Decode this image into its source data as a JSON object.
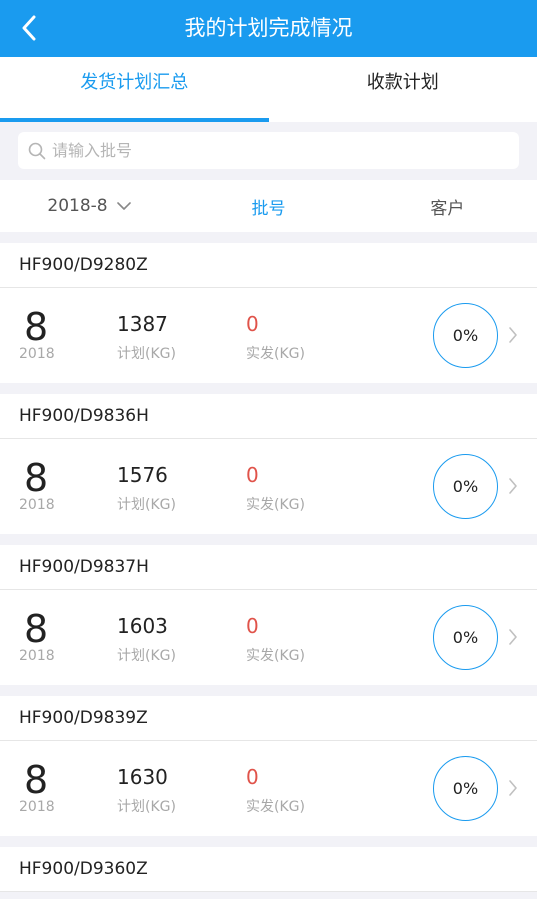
{
  "header": {
    "title": "我的计划完成情况"
  },
  "tabs": [
    {
      "label": "发货计划汇总",
      "active": true
    },
    {
      "label": "收款计划",
      "active": false
    }
  ],
  "search": {
    "placeholder": "请输入批号"
  },
  "filter": {
    "date": "2018-8",
    "batch": "批号",
    "customer": "客户"
  },
  "colors": {
    "accent": "#1a9bef",
    "actual": "#e0534a"
  },
  "items": [
    {
      "batch": "HF900/D9280Z",
      "month": "8",
      "year": "2018",
      "plan_value": "1387",
      "plan_label": "计划(KG)",
      "actual_value": "0",
      "actual_label": "实发(KG)",
      "percent": "0%"
    },
    {
      "batch": "HF900/D9836H",
      "month": "8",
      "year": "2018",
      "plan_value": "1576",
      "plan_label": "计划(KG)",
      "actual_value": "0",
      "actual_label": "实发(KG)",
      "percent": "0%"
    },
    {
      "batch": "HF900/D9837H",
      "month": "8",
      "year": "2018",
      "plan_value": "1603",
      "plan_label": "计划(KG)",
      "actual_value": "0",
      "actual_label": "实发(KG)",
      "percent": "0%"
    },
    {
      "batch": "HF900/D9839Z",
      "month": "8",
      "year": "2018",
      "plan_value": "1630",
      "plan_label": "计划(KG)",
      "actual_value": "0",
      "actual_label": "实发(KG)",
      "percent": "0%"
    },
    {
      "batch": "HF900/D9360Z"
    }
  ]
}
